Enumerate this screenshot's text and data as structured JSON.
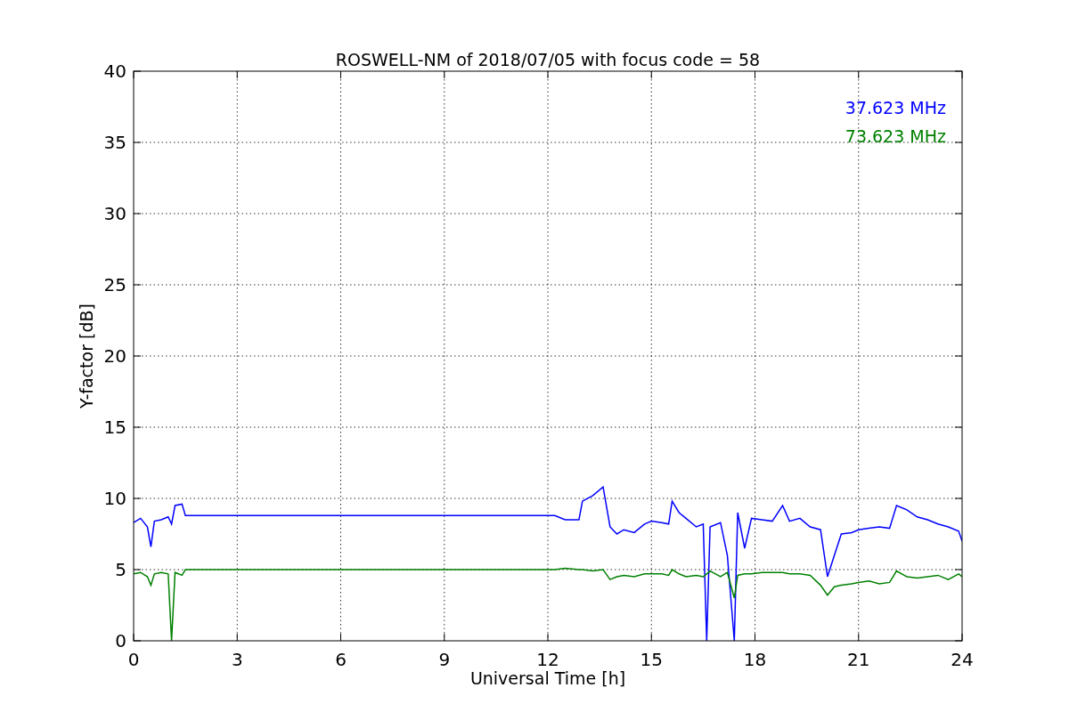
{
  "chart_data": {
    "type": "line",
    "title": "ROSWELL-NM of 2018/07/05 with focus code = 58",
    "xlabel": "Universal Time [h]",
    "ylabel": "Y-factor [dB]",
    "x": [
      0,
      0.2,
      0.4,
      0.5,
      0.6,
      0.8,
      1.0,
      1.1,
      1.2,
      1.4,
      1.5,
      12.2,
      12.5,
      12.9,
      13.0,
      13.3,
      13.6,
      13.8,
      14.0,
      14.2,
      14.5,
      14.8,
      15.0,
      15.3,
      15.5,
      15.6,
      15.8,
      16.0,
      16.3,
      16.5,
      16.6,
      16.7,
      17.0,
      17.2,
      17.4,
      17.5,
      17.7,
      17.9,
      18.2,
      18.5,
      18.8,
      19.0,
      19.3,
      19.6,
      19.9,
      20.1,
      20.3,
      20.5,
      20.8,
      21.0,
      21.3,
      21.6,
      21.9,
      22.1,
      22.4,
      22.7,
      23.0,
      23.3,
      23.6,
      23.9,
      24.0
    ],
    "series": [
      {
        "name": "37.623 MHz",
        "color": "#0000ff",
        "values": [
          8.3,
          8.6,
          8.0,
          6.6,
          8.4,
          8.5,
          8.7,
          8.2,
          9.5,
          9.6,
          8.8,
          8.8,
          8.5,
          8.5,
          9.8,
          10.2,
          10.8,
          8.0,
          7.5,
          7.8,
          7.6,
          8.2,
          8.4,
          8.3,
          8.2,
          9.8,
          9.0,
          8.6,
          8.0,
          8.2,
          0.0,
          8.0,
          8.3,
          6.0,
          0.0,
          9.0,
          6.5,
          8.6,
          8.5,
          8.4,
          9.5,
          8.4,
          8.6,
          8.0,
          7.8,
          4.5,
          6.0,
          7.5,
          7.6,
          7.8,
          7.9,
          8.0,
          7.9,
          9.5,
          9.2,
          8.7,
          8.5,
          8.2,
          8.0,
          7.7,
          7.0
        ]
      },
      {
        "name": "73.623 MHz",
        "color": "#008000",
        "values": [
          4.7,
          4.8,
          4.5,
          3.9,
          4.7,
          4.8,
          4.7,
          0.0,
          4.8,
          4.6,
          5.0,
          5.0,
          5.1,
          5.0,
          5.0,
          4.9,
          5.0,
          4.3,
          4.5,
          4.6,
          4.5,
          4.7,
          4.7,
          4.7,
          4.6,
          5.0,
          4.7,
          4.5,
          4.6,
          4.5,
          4.7,
          4.9,
          4.5,
          4.8,
          3.0,
          4.6,
          4.7,
          4.7,
          4.8,
          4.8,
          4.8,
          4.7,
          4.7,
          4.6,
          3.9,
          3.2,
          3.8,
          3.9,
          4.0,
          4.1,
          4.2,
          4.0,
          4.1,
          4.9,
          4.5,
          4.4,
          4.5,
          4.6,
          4.3,
          4.7,
          4.5
        ]
      }
    ],
    "xlim": [
      0,
      24
    ],
    "ylim": [
      0,
      40
    ],
    "xticks": [
      0,
      3,
      6,
      9,
      12,
      15,
      18,
      21,
      24
    ],
    "yticks": [
      0,
      5,
      10,
      15,
      20,
      25,
      30,
      35,
      40
    ],
    "grid": true
  }
}
